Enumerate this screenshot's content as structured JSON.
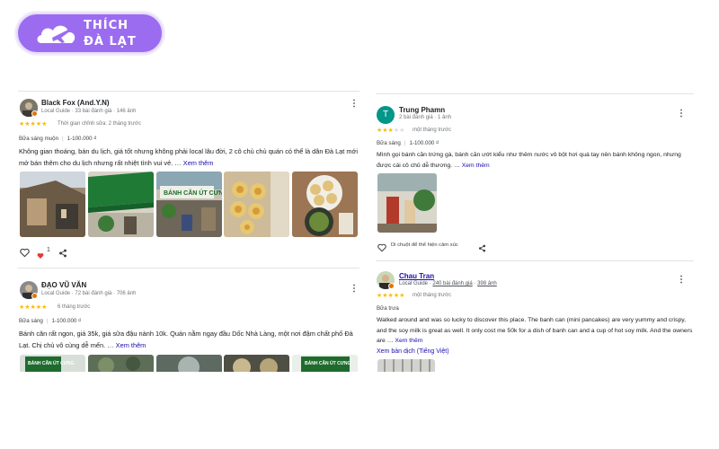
{
  "logo": {
    "line1": "THÍCH",
    "line2": "ĐÀ LẠT"
  },
  "reviews_left": [
    {
      "name": "Black Fox (And.Y.N)",
      "meta": "Local Guide · 33 bài đánh giá · 146 ảnh",
      "rating": 5,
      "when": "Thời gian chỉnh sửa: 2 tháng trước",
      "meal": "Bữa sáng muộn",
      "price": "1-100.000 ₫",
      "text": "Không gian thoáng, bán du lịch, giá tốt nhưng không phải local lâu đời, 2 cô chủ chủ quán có thể là dân Đà Lạt mới mở bán thêm cho du lịch nhưng rất nhiệt tình vui vẻ. …",
      "more": "Xem thêm",
      "photo_sign": "BÁNH CĂN ÚT CƯNG",
      "reaction_count": "1"
    },
    {
      "name": "ĐẠO VŨ VĂN",
      "meta": "Local Guide · 72 bài đánh giá · 706 ảnh",
      "rating": 5,
      "when": "6 tháng trước",
      "meal": "Bữa sáng",
      "price": "1-100.000 ₫",
      "text": "Bánh căn rất ngon, giá 35k, giá sữa đậu nành 10k. Quán nằm ngay đầu Dốc Nhà Làng, một nơi đậm chất phố Đà Lạt. Chị chủ vô cùng dễ mến. …",
      "more": "Xem thêm",
      "photo_sign_1": "BÁNH CĂN ÚT CƯNG",
      "photo_sign_2": "BÁNH CĂN ÚT CƯNG"
    }
  ],
  "reviews_right": [
    {
      "initial": "T",
      "name": "Trung Phamn",
      "meta": "2 bài đánh giá · 1 ảnh",
      "rating": 3,
      "when": "một tháng trước",
      "meal": "Bữa sáng",
      "price": "1-100.000 ₫",
      "text": "Mình gọi bánh căn trứng gà, bánh căn ướt kiểu như thêm nước vô bột hơi quá tay nên bánh không ngon, nhưng được cái cô chủ dễ thương. …",
      "more": "Xem thêm",
      "reaction_hint": "Di chuột để thể hiện cảm xúc"
    },
    {
      "name": "Chau Tran",
      "meta_prefix": "Local Guide · ",
      "meta_reviews": "240 bài đánh giá",
      "meta_sep": " · ",
      "meta_photos": "398 ảnh",
      "rating": 5,
      "when": "một tháng trước",
      "meal": "Bữa trưa",
      "text": "Walked around and was so lucky to discover this place. The banh can (mini pancakes) are very yummy and crispy, and the soy milk is great as well. It only cost me 50k for a dish of banh can and a cup of hot soy milk. And the owners are …",
      "more": "Xem thêm",
      "translate": "Xem bản dịch (Tiếng Việt)"
    }
  ],
  "colors": {
    "accent": "#9b6cf0",
    "star": "#fbbc04",
    "link": "#1a0dab"
  }
}
